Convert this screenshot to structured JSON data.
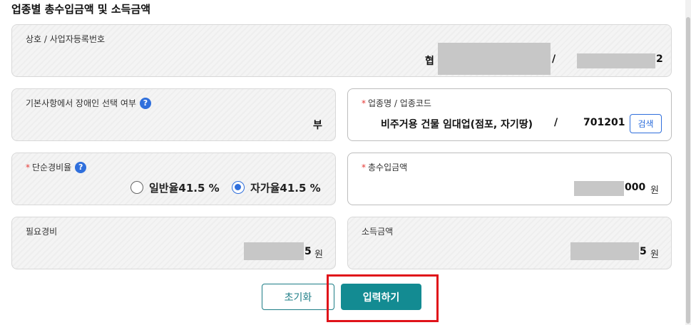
{
  "section": {
    "title": "업종별 총수입금액 및 소득금액"
  },
  "business": {
    "label": "상호 / 사업자등록번호",
    "name_prefix": "협",
    "separator": "/",
    "reg_suffix": "2"
  },
  "disability": {
    "label": "기본사항에서 장애인 선택 여부",
    "help": "?",
    "value": "부"
  },
  "industry": {
    "required_mark": "*",
    "label": "업종명 / 업종코드",
    "name": "비주거용 건물 임대업(점포, 자기땅)",
    "separator": "/",
    "code": "701201",
    "search_label": "검색"
  },
  "expense_rate": {
    "required_mark": "*",
    "label": "단순경비율",
    "help": "?",
    "options": [
      {
        "label": "일반율41.5 %",
        "selected": false
      },
      {
        "label": "자가율41.5 %",
        "selected": true
      }
    ]
  },
  "total_income": {
    "required_mark": "*",
    "label": "총수입금액",
    "suffix": "000",
    "unit": "원"
  },
  "necessary_expense": {
    "label": "필요경비",
    "suffix": "5",
    "unit": "원"
  },
  "income_amount": {
    "label": "소득금액",
    "suffix": "5",
    "unit": "원"
  },
  "actions": {
    "reset_label": "초기화",
    "submit_label": "입력하기"
  },
  "colors": {
    "primary": "#138b92",
    "accent_blue": "#2f6fdc",
    "required": "#e53935",
    "highlight": "#e0131a"
  }
}
